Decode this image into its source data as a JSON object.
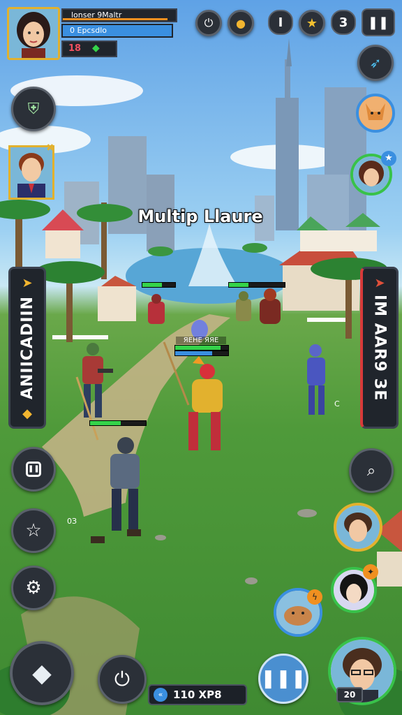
{
  "player": {
    "name": "lonser 9Maltr",
    "sub_stat": "0 Epcsdlo",
    "level": "18",
    "hp_fraction": 0.9,
    "xp_fraction": 0.65
  },
  "top_bar": {
    "resource_count_1": "I",
    "resource_count_2": "3"
  },
  "game_title": "Multip Llaure",
  "left_banner": {
    "text": "ANIICADIIN"
  },
  "right_banner": {
    "text": "IM AAR9 ЗЕ"
  },
  "battle": {
    "center_label": "ЯЕНЕ ЯЯЕ",
    "stray_labels": [
      "0З",
      "C"
    ]
  },
  "bottom_bar": {
    "xp_counter": "110 XP8",
    "hero_level": "20"
  },
  "colors": {
    "hp_green": "#35d34a",
    "xp_blue": "#3a8fe0",
    "portrait_ring": "#38c24a",
    "accent_orange": "#f09020"
  }
}
